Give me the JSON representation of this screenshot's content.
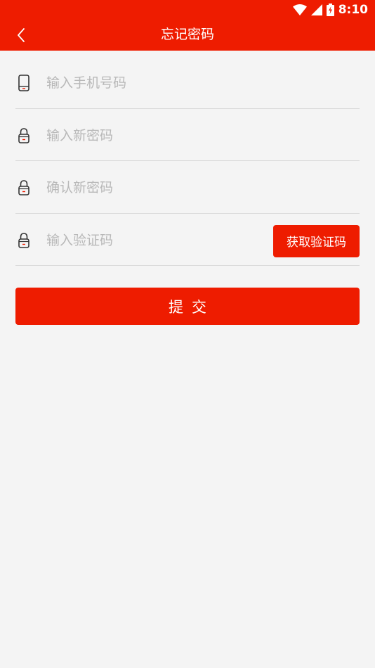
{
  "status_bar": {
    "time": "8:10",
    "icons": [
      "wifi-icon",
      "signal-icon",
      "battery-charging-icon"
    ]
  },
  "app_bar": {
    "back_icon": "chevron-left-icon",
    "title": "忘记密码"
  },
  "form": {
    "phone": {
      "placeholder": "输入手机号码",
      "value": "",
      "icon": "phone-icon"
    },
    "new_password": {
      "placeholder": "输入新密码",
      "value": "",
      "icon": "lock-icon"
    },
    "confirm_password": {
      "placeholder": "确认新密码",
      "value": "",
      "icon": "lock-icon"
    },
    "verify_code": {
      "placeholder": "输入验证码",
      "value": "",
      "icon": "lock-icon"
    },
    "get_code_label": "获取验证码",
    "submit_label": "提交"
  },
  "colors": {
    "brand": "#ee1c00",
    "background": "#f4f4f4",
    "divider": "#d9d9d9",
    "placeholder": "#b8b8b8"
  }
}
